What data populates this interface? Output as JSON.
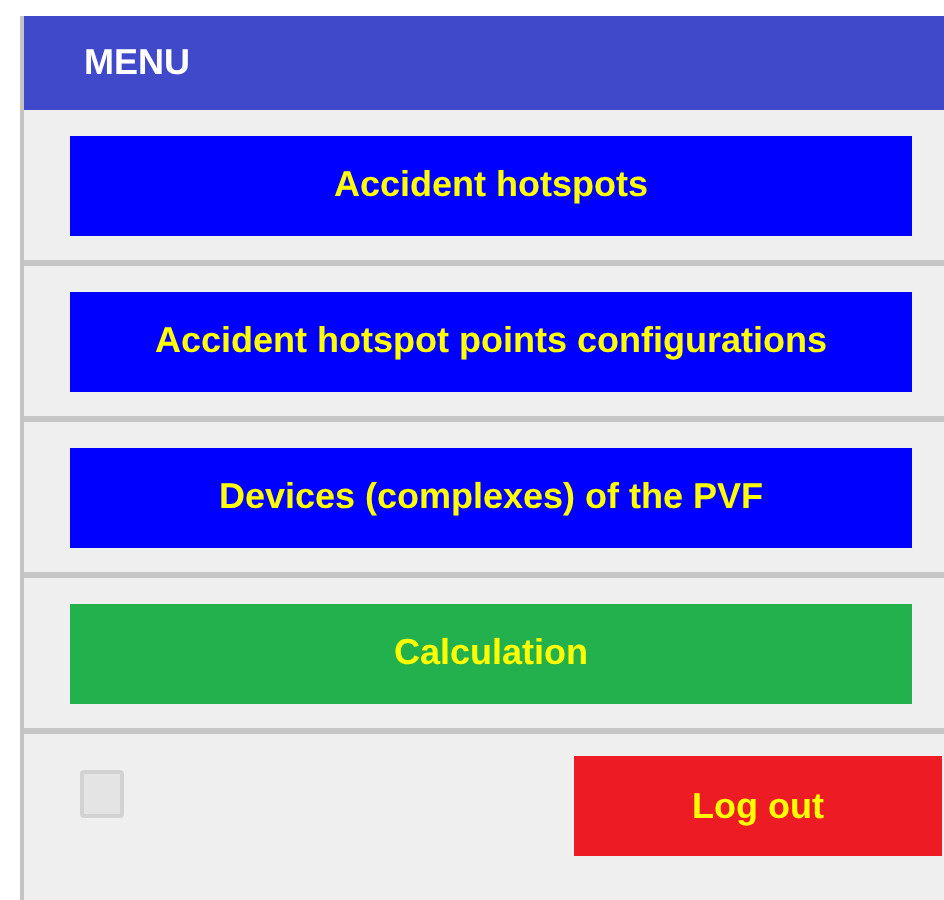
{
  "header": {
    "title": "MENU"
  },
  "menu_items": [
    {
      "label": "Accident hotspots",
      "color": "#0000ff"
    },
    {
      "label": "Accident hotspot points configurations",
      "color": "#0000ff"
    },
    {
      "label": "Devices (complexes) of the PVF",
      "color": "#0000ff"
    },
    {
      "label": "Calculation",
      "color": "#22b14c"
    }
  ],
  "footer": {
    "checkbox": {
      "checked": false
    },
    "logout_button": {
      "label": "Log out",
      "color": "#ed1c24"
    }
  }
}
